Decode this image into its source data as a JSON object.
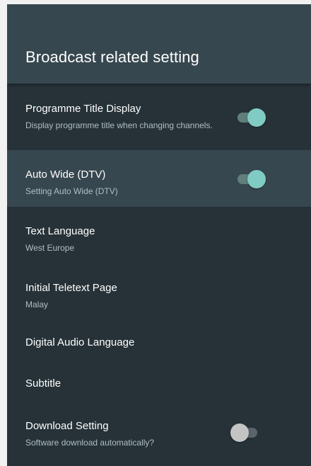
{
  "header": {
    "title": "Broadcast related setting"
  },
  "items": [
    {
      "title": "Programme Title Display",
      "subtitle": "Display programme title when changing channels.",
      "toggle": true
    },
    {
      "title": "Auto Wide (DTV)",
      "subtitle": "Setting Auto Wide (DTV)",
      "toggle": true,
      "focused": true
    },
    {
      "title": "Text Language",
      "subtitle": "West Europe"
    },
    {
      "title": "Initial Teletext Page",
      "subtitle": "Malay"
    },
    {
      "title": "Digital Audio Language"
    },
    {
      "title": "Subtitle"
    },
    {
      "title": "Download Setting",
      "subtitle": "Software download automatically?",
      "toggle": false
    }
  ],
  "colors": {
    "panel_bg": "#263238",
    "header_bg": "#37474f",
    "focus_bg": "#37474f",
    "toggle_on_thumb": "#80cbc4",
    "toggle_off_thumb": "#c4c4c4"
  }
}
